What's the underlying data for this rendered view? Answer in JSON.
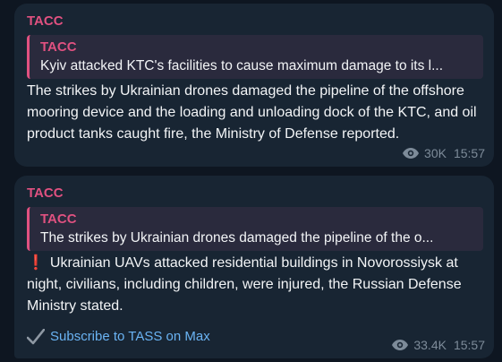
{
  "colors": {
    "accent": "#e05180",
    "link": "#6ab3f3",
    "bubble": "#182533",
    "background": "#0e1621",
    "meta": "#7d8b99"
  },
  "messages": [
    {
      "sender": "TACC",
      "reply": {
        "sender": "TACC",
        "text": "Kyiv attacked KTC's facilities to cause maximum damage to its l..."
      },
      "body": "The strikes by Ukrainian drones damaged the pipeline of the offshore mooring device and the loading and unloading dock of the KTC, and oil product tanks caught fire, the Ministry of Defense reported.",
      "views": "30K",
      "time": "15:57"
    },
    {
      "sender": "TACC",
      "reply": {
        "sender": "TACC",
        "text": "The strikes by Ukrainian drones damaged the pipeline of the o..."
      },
      "prefix_icon": "exclamation-icon",
      "body": "Ukrainian UAVs attacked residential buildings in Novorossiysk at night, civilians, including children, were injured, the Russian Defense Ministry stated.",
      "link": {
        "icon": "checkmark-icon",
        "text": "Subscribe to TASS on Max"
      },
      "views": "33.4K",
      "time": "15:57"
    }
  ]
}
